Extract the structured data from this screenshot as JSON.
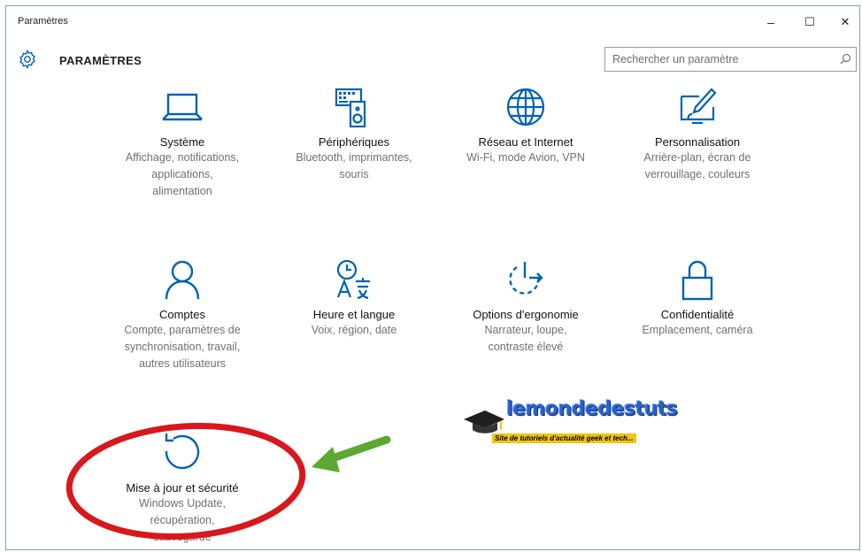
{
  "window": {
    "title": "Paramètres",
    "minimize_glyph": "–",
    "maximize_glyph": "☐",
    "close_glyph": "✕"
  },
  "header": {
    "title": "PARAMÈTRES",
    "icon": "gear-icon"
  },
  "search": {
    "placeholder": "Rechercher un paramètre",
    "icon": "search-icon"
  },
  "tiles": [
    {
      "id": "systeme",
      "icon": "laptop-icon",
      "name": "Système",
      "desc": [
        "Affichage, notifications,",
        "applications,",
        "alimentation"
      ]
    },
    {
      "id": "peripheriques",
      "icon": "keyboard-speaker-icon",
      "name": "Périphériques",
      "desc": [
        "Bluetooth, imprimantes,",
        "souris"
      ]
    },
    {
      "id": "reseau",
      "icon": "globe-icon",
      "name": "Réseau et Internet",
      "desc": [
        "Wi-Fi, mode Avion, VPN"
      ]
    },
    {
      "id": "personnalisation",
      "icon": "paint-monitor-icon",
      "name": "Personnalisation",
      "desc": [
        "Arrière-plan, écran de",
        "verrouillage, couleurs"
      ]
    },
    {
      "id": "comptes",
      "icon": "person-icon",
      "name": "Comptes",
      "desc": [
        "Compte, paramètres de",
        "synchronisation, travail,",
        "autres utilisateurs"
      ]
    },
    {
      "id": "heure",
      "icon": "clock-language-icon",
      "name": "Heure et langue",
      "desc": [
        "Voix, région, date"
      ]
    },
    {
      "id": "ergonomie",
      "icon": "ease-of-access-icon",
      "name": "Options d'ergonomie",
      "desc": [
        "Narrateur, loupe,",
        "contraste élevé"
      ]
    },
    {
      "id": "confidentialite",
      "icon": "lock-icon",
      "name": "Confidentialité",
      "desc": [
        "Emplacement, caméra"
      ]
    },
    {
      "id": "maj",
      "icon": "update-refresh-icon",
      "name": "Mise à jour et sécurité",
      "desc": [
        "Windows Update,",
        "récupération,",
        "sauvegarde"
      ]
    }
  ],
  "watermark": {
    "text": "lemondedestuts",
    "tagline": "Site de tutoriels d'actualité geek et tech..."
  },
  "colors": {
    "accent": "#0063b1",
    "annotation_red": "#d8181c",
    "annotation_green": "#5ca832"
  }
}
